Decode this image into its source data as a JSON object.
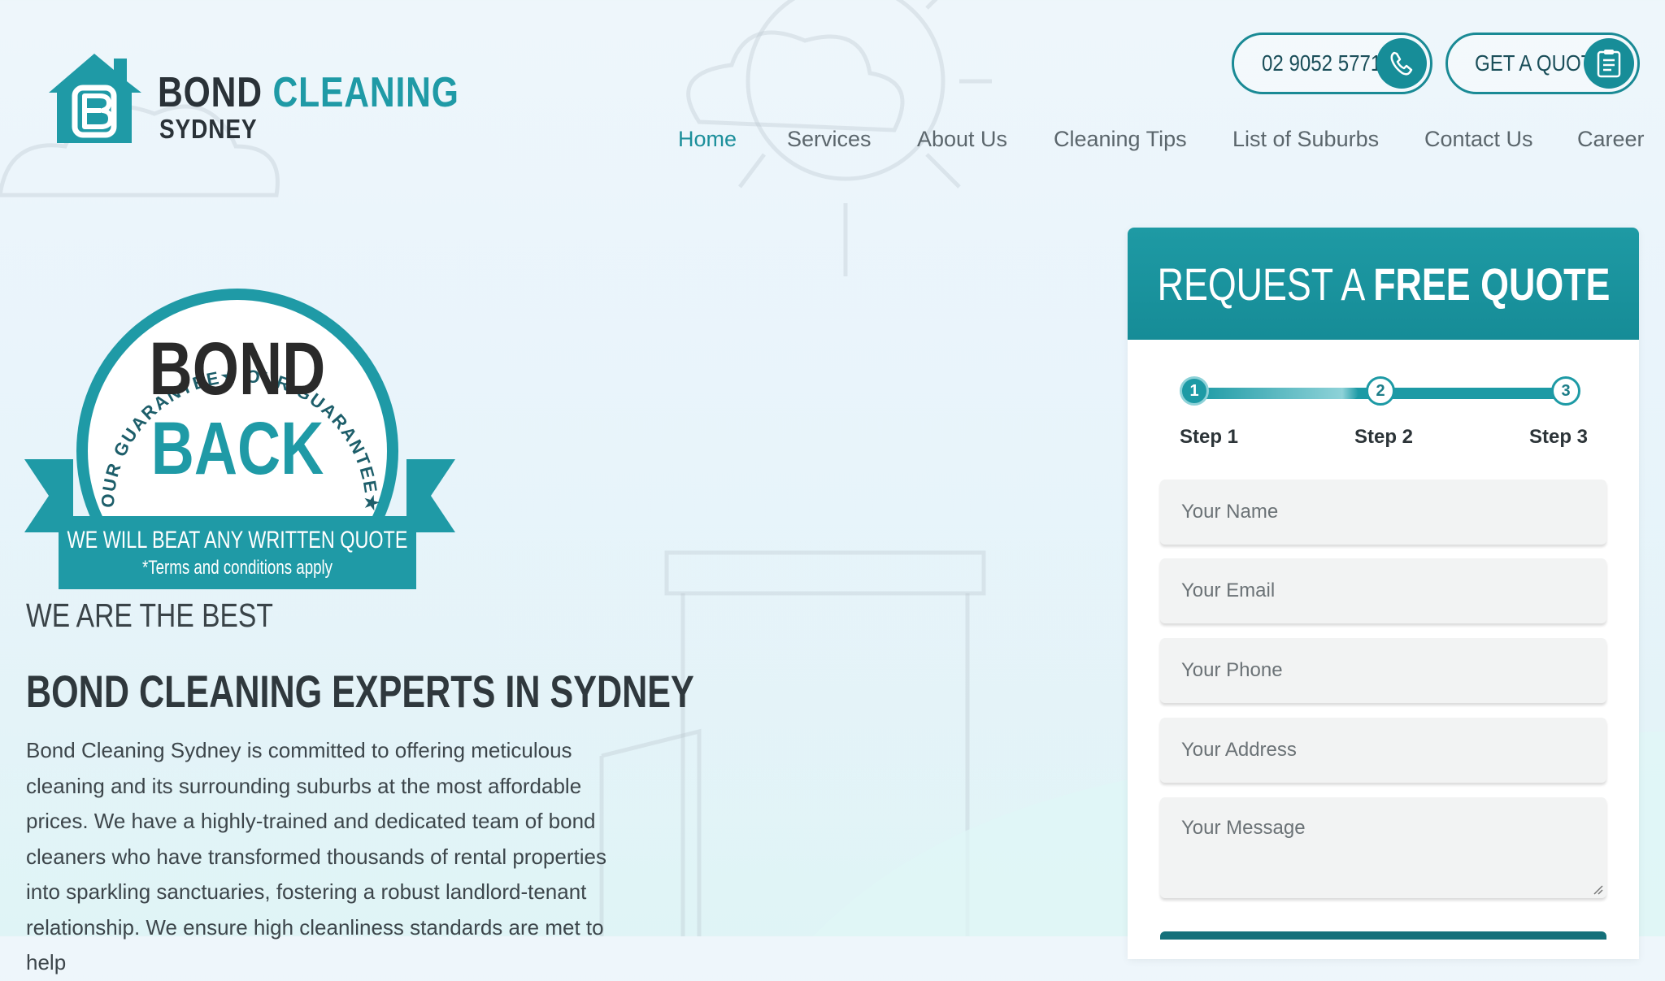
{
  "brand": {
    "name_1": "BOND",
    "name_2": "CLEANING",
    "name_3": "SYDNEY",
    "accent_color": "#1f9aa6",
    "dark_color": "#2a3238"
  },
  "header": {
    "phone_label": "02 9052 5771",
    "quote_label": "GET A QUOTE",
    "phone_icon": "phone-icon",
    "quote_icon": "clipboard-icon"
  },
  "nav": {
    "items": [
      {
        "label": "Home",
        "active": true
      },
      {
        "label": "Services"
      },
      {
        "label": "About Us"
      },
      {
        "label": "Cleaning Tips"
      },
      {
        "label": "List of Suburbs"
      },
      {
        "label": "Contact Us"
      },
      {
        "label": "Career"
      }
    ]
  },
  "badge": {
    "ring_text": "OUR GUARANTEE★ OUR GUARANTEE★ OUR GUARANTEE★",
    "line_1": "BOND",
    "line_2": "BACK",
    "ribbon_1": "WE WILL BEAT ANY WRITTEN QUOTE",
    "ribbon_2": "*Terms and conditions apply"
  },
  "content": {
    "kicker": "WE ARE THE BEST",
    "headline": "BOND CLEANING EXPERTS IN SYDNEY",
    "body": "Bond Cleaning Sydney is committed to offering meticulous cleaning and its surrounding suburbs at the most affordable prices. We have a highly-trained and dedicated team of bond cleaners who have transformed thousands of rental properties into sparkling sanctuaries, fostering a robust landlord-tenant relationship. We ensure high cleanliness standards are met to help"
  },
  "form": {
    "title_regular": "REQUEST A ",
    "title_bold": "FREE QUOTE",
    "steps": [
      {
        "number": "1",
        "label": "Step 1"
      },
      {
        "number": "2",
        "label": "Step 2"
      },
      {
        "number": "3",
        "label": "Step 3"
      }
    ],
    "current_step": 1,
    "fields": {
      "name_placeholder": "Your Name",
      "email_placeholder": "Your Email",
      "phone_placeholder": "Your Phone",
      "address_placeholder": "Your Address",
      "message_placeholder": "Your Message"
    }
  }
}
